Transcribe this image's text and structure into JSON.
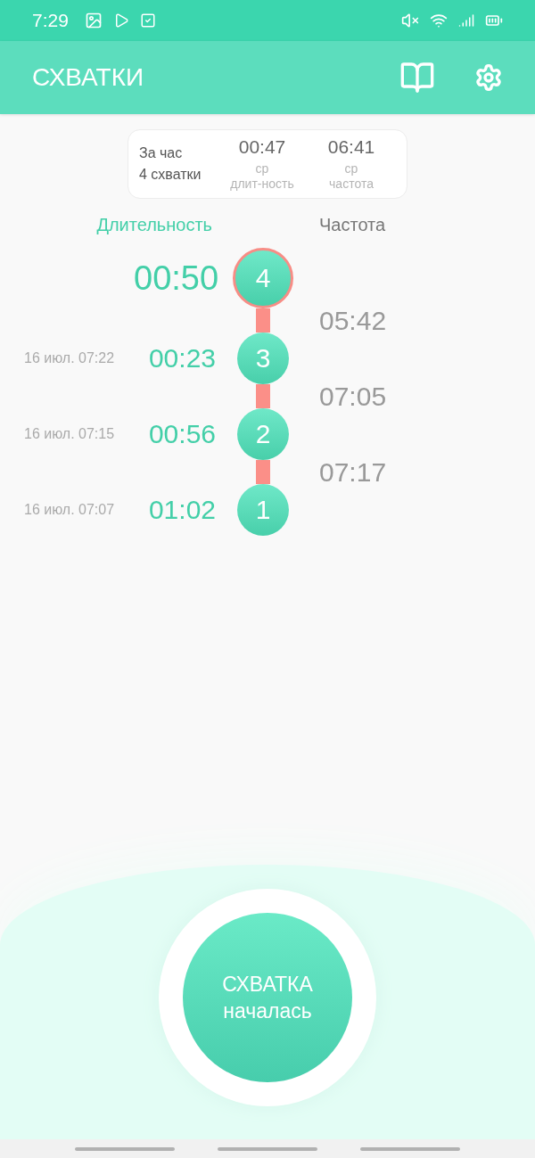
{
  "status_bar": {
    "time": "7:29"
  },
  "app_bar": {
    "title": "СХВАТКИ"
  },
  "summary": {
    "period": "За час",
    "count": "4 схватки",
    "stats": [
      {
        "value": "00:47",
        "label_1": "ср",
        "label_2": "длит-ность"
      },
      {
        "value": "06:41",
        "label_1": "ср",
        "label_2": "частота"
      }
    ]
  },
  "columns": {
    "duration": "Длительность",
    "frequency": "Частота"
  },
  "contractions": [
    {
      "number": "4",
      "duration": "00:50",
      "current": true,
      "interval": "05:42"
    },
    {
      "number": "3",
      "duration": "00:23",
      "date": "16 июл. 07:22",
      "current": false,
      "interval": "07:05"
    },
    {
      "number": "2",
      "duration": "00:56",
      "date": "16 июл. 07:15",
      "current": false,
      "interval": "07:17"
    },
    {
      "number": "1",
      "duration": "01:02",
      "date": "16 июл. 07:07",
      "current": false
    }
  ],
  "action_button": {
    "line_1": "СХВАТКА",
    "line_2": "началась"
  }
}
